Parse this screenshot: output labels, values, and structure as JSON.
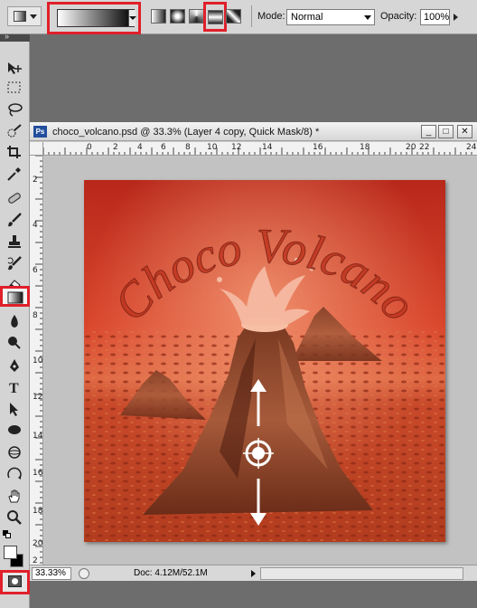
{
  "options_bar": {
    "mode_label": "Mode:",
    "mode_value": "Normal",
    "opacity_label": "Opacity:",
    "opacity_value": "100%"
  },
  "document": {
    "title": "choco_volcano.psd @ 33.3% (Layer 4 copy, Quick Mask/8) *",
    "ps_icon": "Ps",
    "ruler_h": [
      "0",
      "2",
      "4",
      "6",
      "8",
      "10",
      "12",
      "14",
      "16",
      "18",
      "20",
      "22",
      "24"
    ],
    "ruler_v": [
      "2",
      "4",
      "6",
      "8",
      "10",
      "12",
      "14",
      "16",
      "18",
      "20",
      "2"
    ],
    "artwork_text": "Choco Volcano",
    "zoom": "33.33%",
    "doc_info": "Doc: 4.12M/52.1M",
    "window_buttons": [
      "_",
      "□",
      "✕"
    ]
  },
  "colors": {
    "highlight": "#e0202a",
    "artwork_bg": "#c8321e",
    "foreground": "#ffffff",
    "background": "#000000"
  },
  "tools": [
    "move-icon",
    "marquee-icon",
    "lasso-icon",
    "quick-select-icon",
    "crop-icon",
    "eyedropper-icon",
    "healing-brush-icon",
    "brush-icon",
    "clone-stamp-icon",
    "history-brush-icon",
    "eraser-icon",
    "gradient-icon",
    "blur-icon",
    "dodge-icon",
    "pen-icon",
    "type-icon",
    "path-select-icon",
    "shape-icon",
    "3d-rotate-icon",
    "3d-orbit-icon",
    "hand-icon",
    "zoom-icon"
  ]
}
